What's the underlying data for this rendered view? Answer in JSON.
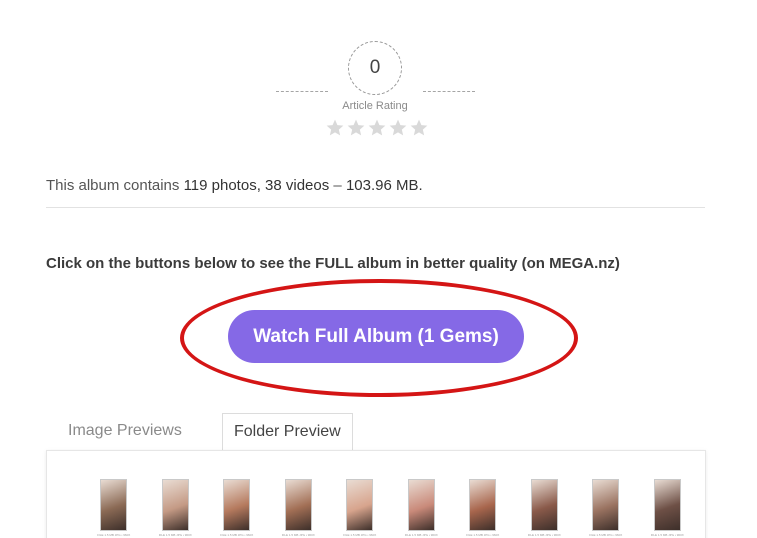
{
  "rating": {
    "value": "0",
    "label": "Article Rating",
    "stars_total": 5,
    "stars_filled": 0,
    "star_color": "#d9d9d9",
    "star_icons": [
      "star-icon",
      "star-icon",
      "star-icon",
      "star-icon",
      "star-icon"
    ]
  },
  "album": {
    "prefix": "This album contains ",
    "photos": "119 photos, 38 videos",
    "separator": " – ",
    "size": "103.96 MB."
  },
  "instruction": "Click on the buttons below to see the FULL album in better quality (on MEGA.nz)",
  "cta": {
    "label": "Watch Full Album (1 Gems)",
    "button_color": "#8569e6",
    "highlight_color": "#d41515"
  },
  "tabs": {
    "image_previews": "Image Previews",
    "folder_preview": "Folder Preview"
  },
  "thumbnails": {
    "count": 10,
    "captions": [
      "FILE 1.5 MB JPG • 960X",
      "FILE 1.5 MB JPG • 960X",
      "FILE 1.5 MB JPG • 960X",
      "FILE 1.5 MB JPG • 960X",
      "FILE 1.5 MB JPG • 960X",
      "FILE 1.5 MB JPG • 960X",
      "FILE 1.5 MB JPG • 960X",
      "FILE 1.5 MB JPG • 960X",
      "FILE 1.5 MB JPG • 960X",
      "FILE 1.5 MB JPG • 960X"
    ],
    "tints": [
      "#8b6a55",
      "#c49a85",
      "#b57a5e",
      "#a26f55",
      "#d7a48d",
      "#c98a7a",
      "#a8664d",
      "#8a5a4a",
      "#9a7361",
      "#6e5046"
    ]
  }
}
